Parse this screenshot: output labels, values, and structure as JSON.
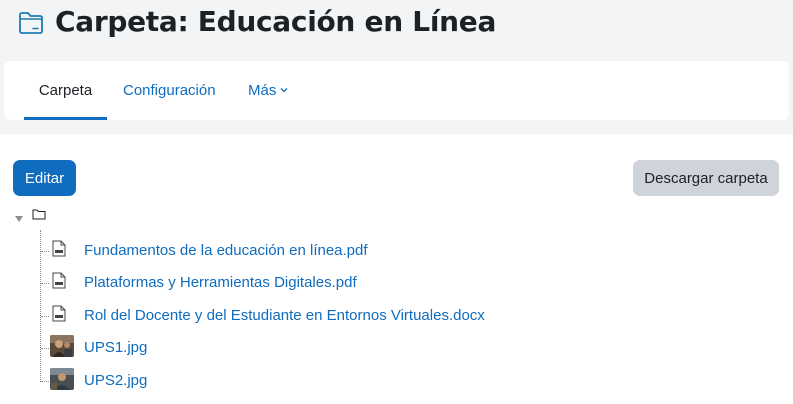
{
  "header": {
    "title": "Carpeta: Educación en Línea",
    "icon": "folder-icon"
  },
  "nav": {
    "tabs": [
      {
        "label": "Carpeta",
        "active": true
      },
      {
        "label": "Configuración",
        "active": false
      },
      {
        "label": "Más",
        "active": false
      }
    ]
  },
  "actions": {
    "edit_label": "Editar",
    "download_label": "Descargar carpeta"
  },
  "tree": {
    "files": [
      {
        "name": "Fundamentos de la educación en línea.pdf",
        "icon": "pdf-file-icon"
      },
      {
        "name": "Plataformas y Herramientas Digitales.pdf",
        "icon": "pdf-file-icon"
      },
      {
        "name": "Rol del Docente y del Estudiante en Entornos Virtuales.docx",
        "icon": "doc-file-icon"
      },
      {
        "name": "UPS1.jpg",
        "icon": "image-thumbnail"
      },
      {
        "name": "UPS2.jpg",
        "icon": "image-thumbnail"
      }
    ]
  },
  "colors": {
    "accent": "#0f6cbf",
    "page_bg": "#f3f4f6",
    "secondary_button": "#ced4da"
  }
}
